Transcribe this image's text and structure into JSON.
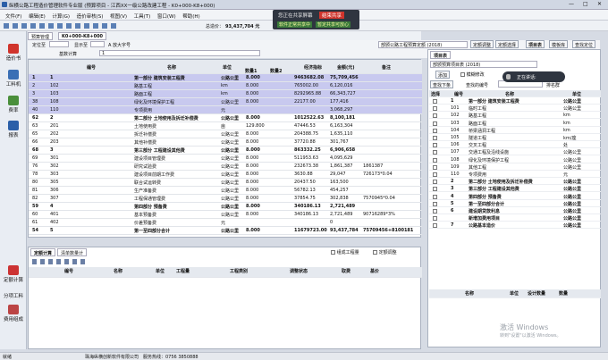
{
  "app": {
    "title": "纵横公路工程造价管理软件专业版 (预算项目 - 江西XX一级公路改建工程 - K0+000-K8+000)"
  },
  "banner": {
    "text": "您正在共享屏幕",
    "stop": "结束共享",
    "left": "软件正常共享中",
    "right": "暂定共享可放心"
  },
  "menu": [
    "文件(F)",
    "编辑(E)",
    "计算(G)",
    "造价审核(S)",
    "视图(V)",
    "工具(T)",
    "窗口(W)",
    "帮助(H)"
  ],
  "toolbar": {
    "total_label": "总造价：",
    "total_value": "93,437,704 元"
  },
  "sidebar": [
    {
      "label": "造价书",
      "color": "#d0342c"
    },
    {
      "label": "工料机",
      "color": "#3a6fb5"
    },
    {
      "label": "费率",
      "color": "#4a8f3b"
    },
    {
      "label": "报表",
      "color": "#2b5fa8"
    }
  ],
  "sidebar_lower": [
    {
      "label": "定额计算"
    },
    {
      "label": "分项工料"
    },
    {
      "label": "费用组成"
    }
  ],
  "top_tabs": [
    "预算管理",
    "K0+000-K8+000"
  ],
  "grid_toolbar": {
    "std": "定位至",
    "show": "显示至",
    "font": "A 放大字号",
    "calc": "基数计算",
    "calc_mode": "1",
    "std_name": "部颁公路工程预算定额 (2018)",
    "std_btn1": "定额调整",
    "std_btn2": "定额选择",
    "tab_project": "项目表",
    "tab_template": "模板库",
    "tab_query": "查找定位"
  },
  "grid": {
    "headers": [
      "编号",
      "名称",
      "单位",
      "数量1",
      "数量2",
      "经济指标",
      "金额(元)",
      "备注"
    ],
    "rows": [
      {
        "n": "1",
        "code": "1",
        "name": "第一部分  建筑安装工程费",
        "unit": "公路公里",
        "q": "8.000",
        "eco": "9463682.08",
        "amt": "75,709,456",
        "note": "",
        "bold": true,
        "sel": true
      },
      {
        "n": "2",
        "code": "102",
        "name": "路基工程",
        "unit": "km",
        "q": "8.000",
        "eco": "765002.00",
        "amt": "6,120,016",
        "note": "",
        "sel": true
      },
      {
        "n": "3",
        "code": "103",
        "name": "路面工程",
        "unit": "km",
        "q": "8.000",
        "eco": "8292965.88",
        "amt": "66,343,727",
        "note": "",
        "sel": true
      },
      {
        "n": "38",
        "code": "108",
        "name": "绿化及环境保护工程",
        "unit": "公路公里",
        "q": "8.000",
        "eco": "22177.00",
        "amt": "177,416",
        "note": "",
        "sel": true
      },
      {
        "n": "40",
        "code": "110",
        "name": "专项费用",
        "unit": "元",
        "q": "",
        "eco": "",
        "amt": "3,068,297",
        "note": "",
        "sel": true
      },
      {
        "n": "62",
        "code": "2",
        "name": "第二部分  土地使用及拆迁补偿费",
        "unit": "公路公里",
        "q": "8.000",
        "eco": "1012522.63",
        "amt": "8,100,181",
        "note": "",
        "bold": true
      },
      {
        "n": "63",
        "code": "201",
        "name": "土地使用费",
        "unit": "亩",
        "q": "129.800",
        "eco": "47446.53",
        "amt": "6,163,304",
        "note": ""
      },
      {
        "n": "65",
        "code": "202",
        "name": "拆迁补偿费",
        "unit": "公路公里",
        "q": "8.000",
        "eco": "204388.75",
        "amt": "1,635,110",
        "note": ""
      },
      {
        "n": "66",
        "code": "203",
        "name": "其他补偿费",
        "unit": "公路公里",
        "q": "8.000",
        "eco": "37720.88",
        "amt": "301,767",
        "note": ""
      },
      {
        "n": "68",
        "code": "3",
        "name": "第三部分  工程建设其他费",
        "unit": "公路公里",
        "q": "8.000",
        "eco": "863332.25",
        "amt": "6,906,658",
        "note": "",
        "bold": true
      },
      {
        "n": "69",
        "code": "301",
        "name": "建设项目管理费",
        "unit": "公路公里",
        "q": "8.000",
        "eco": "511953.63",
        "amt": "4,095,629",
        "note": ""
      },
      {
        "n": "76",
        "code": "302",
        "name": "研究试验费",
        "unit": "公路公里",
        "q": "8.000",
        "eco": "232673.38",
        "amt": "1,861,387",
        "note": "1861387"
      },
      {
        "n": "78",
        "code": "303",
        "name": "建设项目前期工作费",
        "unit": "公路公里",
        "q": "8.000",
        "eco": "3630.88",
        "amt": "29,047",
        "note": "726173*0.04"
      },
      {
        "n": "80",
        "code": "305",
        "name": "联合试运转费",
        "unit": "公路公里",
        "q": "8.000",
        "eco": "20437.50",
        "amt": "163,500",
        "note": ""
      },
      {
        "n": "81",
        "code": "306",
        "name": "生产准备费",
        "unit": "公路公里",
        "q": "8.000",
        "eco": "56782.13",
        "amt": "454,257",
        "note": ""
      },
      {
        "n": "82",
        "code": "307",
        "name": "工程保通管理费",
        "unit": "公路公里",
        "q": "8.000",
        "eco": "37854.75",
        "amt": "302,838",
        "note": "7570945*0.04"
      },
      {
        "n": "59",
        "code": "4",
        "name": "第四部分  预备费",
        "unit": "公路公里",
        "q": "8.000",
        "eco": "340186.13",
        "amt": "2,721,489",
        "note": "",
        "bold": true
      },
      {
        "n": "60",
        "code": "401",
        "name": "基本预备费",
        "unit": "公路公里",
        "q": "8.000",
        "eco": "340186.13",
        "amt": "2,721,489",
        "note": "90716289*3%"
      },
      {
        "n": "61",
        "code": "402",
        "name": "价差预备费",
        "unit": "元",
        "q": "",
        "eco": "",
        "amt": "0",
        "note": ""
      },
      {
        "n": "54",
        "code": "5",
        "name": "第一至四部分合计",
        "unit": "公路公里",
        "q": "8.000",
        "eco": "11679723.00",
        "amt": "93,437,784",
        "note": "75709456+8100181",
        "bold": true
      }
    ]
  },
  "lower": {
    "tab1": "定额计算",
    "tab2": "清单数量计",
    "cols": [
      "编号",
      "名称",
      "单位",
      "工程量",
      "工程类别",
      "调整状态",
      "取费",
      "基价"
    ],
    "chk1": "组成工程量",
    "chk2": "定额调整"
  },
  "rpanel": {
    "title": "项目表",
    "std": "部颁预算项目表 (2018)",
    "btn_add": "添加",
    "chk_mod": "模糊修改",
    "btn_find": "查找下条",
    "find_label": "查找的编号",
    "find_label2": "排名群",
    "headers": [
      "选择",
      "编号",
      "名称",
      "单位"
    ],
    "rows": [
      {
        "code": "1",
        "name": "第一部分  建筑安装工程费",
        "unit": "公路公里",
        "bold": true
      },
      {
        "code": "101",
        "name": "临时工程",
        "unit": "公路公里"
      },
      {
        "code": "102",
        "name": "路基工程",
        "unit": "km"
      },
      {
        "code": "103",
        "name": "路面工程",
        "unit": "km"
      },
      {
        "code": "104",
        "name": "桥梁涵洞工程",
        "unit": "km"
      },
      {
        "code": "105",
        "name": "隧道工程",
        "unit": "km/座"
      },
      {
        "code": "106",
        "name": "交叉工程",
        "unit": "处"
      },
      {
        "code": "107",
        "name": "交通工程及沿线设施",
        "unit": "公路公里"
      },
      {
        "code": "108",
        "name": "绿化及环境保护工程",
        "unit": "公路公里"
      },
      {
        "code": "109",
        "name": "其他工程",
        "unit": "公路公里"
      },
      {
        "code": "110",
        "name": "专项费用",
        "unit": "元"
      },
      {
        "code": "2",
        "name": "第二部分  土地使用及拆迁补偿费",
        "unit": "公路公里",
        "bold": true
      },
      {
        "code": "3",
        "name": "第三部分  工程建设其他费",
        "unit": "公路公里",
        "bold": true
      },
      {
        "code": "4",
        "name": "第四部分  预备费",
        "unit": "公路公里",
        "bold": true
      },
      {
        "code": "5",
        "name": "第一至四部分合计",
        "unit": "公路公里",
        "bold": true
      },
      {
        "code": "6",
        "name": "建设期贷款利息",
        "unit": "公路公里",
        "bold": true
      },
      {
        "code": "",
        "name": "新增加费用项目",
        "unit": "公路公里",
        "bold": true
      },
      {
        "code": "7",
        "name": "公路基本造价",
        "unit": "公路公里",
        "bold": true
      }
    ],
    "lower_cols": [
      "名称",
      "单位",
      "设计数量",
      "数量"
    ]
  },
  "popup": {
    "text": "正在讲话:"
  },
  "watermark": {
    "line1": "激活 Windows",
    "line2": "转到\"设置\"以激活 Windows。"
  },
  "status": {
    "left": "就绪",
    "company": "珠海纵横创新软件有限公司",
    "phone": "服务热线：0756 3850888"
  }
}
